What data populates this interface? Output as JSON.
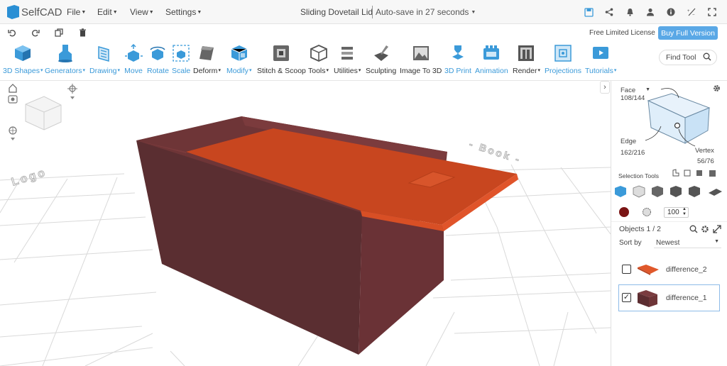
{
  "app": {
    "name": "SelfCAD",
    "brand_color": "#2a8fd4"
  },
  "menu": {
    "file": "File",
    "edit": "Edit",
    "view": "View",
    "settings": "Settings"
  },
  "document": {
    "title": "Sliding Dovetail Lid",
    "autosave": "Auto-save in 27 seconds"
  },
  "license": {
    "text": "Free Limited License",
    "buy_label": "Buy Full Version"
  },
  "toolbar": {
    "shapes": "3D Shapes",
    "generators": "Generators",
    "drawing": "Drawing",
    "move": "Move",
    "rotate": "Rotate",
    "scale": "Scale",
    "deform": "Deform",
    "modify": "Modify",
    "stitch": "Stitch & Scoop",
    "tools": "Tools",
    "utilities": "Utilities",
    "sculpting": "Sculpting",
    "image3d": "Image To 3D",
    "print": "3D Print",
    "animation": "Animation",
    "render": "Render",
    "projections": "Projections",
    "tutorials": "Tutorials"
  },
  "search": {
    "placeholder": "Find Tool"
  },
  "scene": {
    "text_left": "Logo",
    "text_right": "- Book -",
    "box_color": "#643236",
    "lid_color": "#c8461f"
  },
  "panel": {
    "face_label": "Face",
    "face_count": "108/144",
    "edge_label": "Edge",
    "edge_count": "162/216",
    "vertex_label": "Vertex",
    "vertex_count": "56/76",
    "selection_tools": "Selection Tools",
    "opacity_value": "100",
    "objects_label": "Objects 1 / 2",
    "sort_label": "Sort by",
    "sort_value": "Newest",
    "objects": [
      {
        "name": "difference_2",
        "checked": false,
        "color": "#d9582e"
      },
      {
        "name": "difference_1",
        "checked": true,
        "color": "#6b3438"
      }
    ]
  }
}
